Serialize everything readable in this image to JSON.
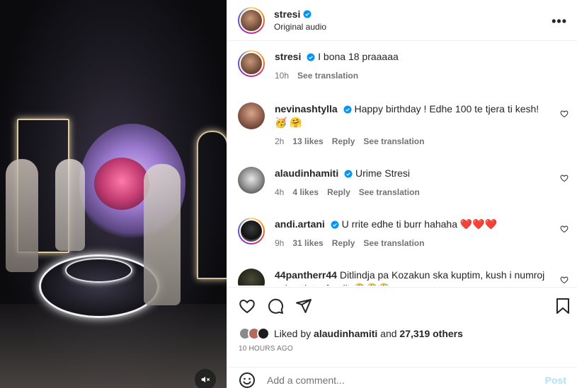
{
  "post": {
    "username": "stresi",
    "audio": "Original audio",
    "more_label": "•••"
  },
  "caption": {
    "username": "stresi",
    "text": "I bona 18 praaaaa",
    "time": "10h",
    "see_translation": "See translation"
  },
  "comments": [
    {
      "username": "nevinashtylla",
      "verified": true,
      "text": "Happy birthday ! Edhe 100 te tjera ti kesh! 🥳 🤗",
      "time": "2h",
      "likes": "13 likes",
      "reply": "Reply",
      "see_translation": "See translation"
    },
    {
      "username": "alaudinhamiti",
      "verified": true,
      "text": "Urime Stresi",
      "time": "4h",
      "likes": "4 likes",
      "reply": "Reply",
      "see_translation": "See translation"
    },
    {
      "username": "andi.artani",
      "verified": true,
      "text": "U rrite edhe ti burr hahaha ❤️❤️❤️",
      "time": "9h",
      "likes": "31 likes",
      "reply": "Reply",
      "see_translation": "See translation"
    },
    {
      "username": "44pantherr44",
      "verified": false,
      "text": "Ditlindja pa Kozakun ska kuptim, kush i numroj sekondat e fundit 🤣🤣🤣"
    }
  ],
  "likes": {
    "prefix": "Liked by",
    "user": "alaudinhamiti",
    "and": "and",
    "others": "27,319 others"
  },
  "timestamp": "10 HOURS AGO",
  "add_comment": {
    "placeholder": "Add a comment...",
    "post_label": "Post"
  },
  "colors": {
    "verified": "#0095f6",
    "post_disabled": "#b2dffc",
    "heart_red": "#ed1c24"
  }
}
